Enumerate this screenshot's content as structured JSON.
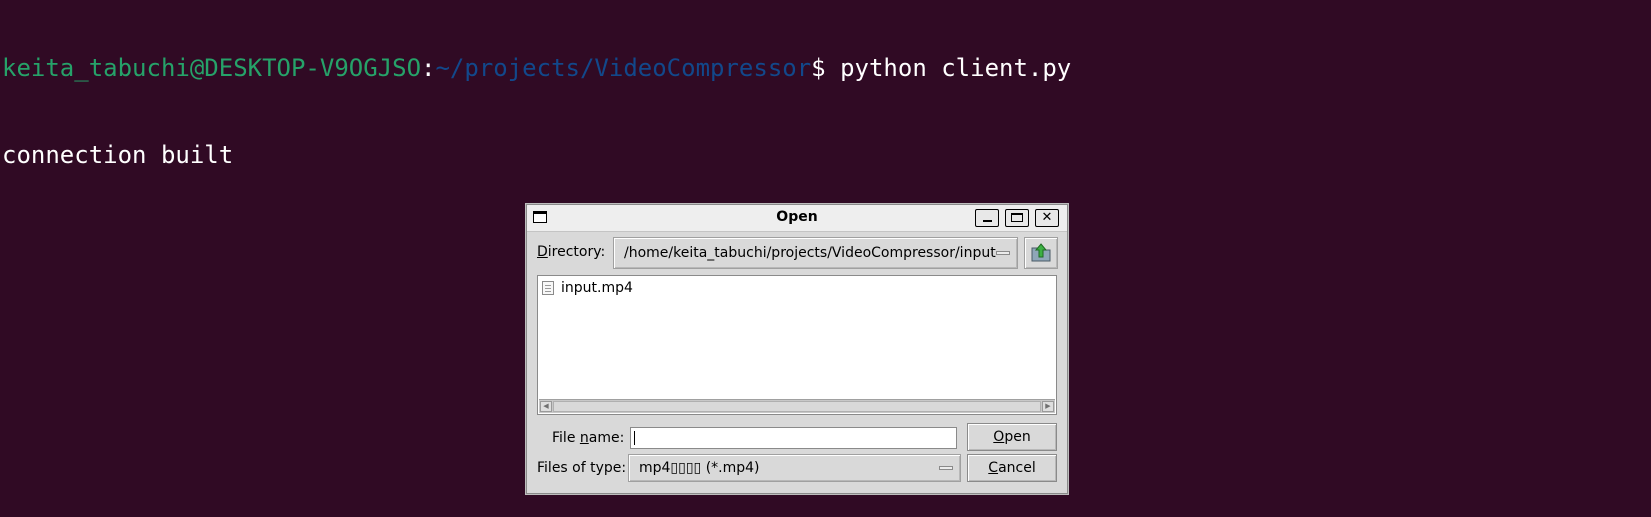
{
  "terminal": {
    "user_host": "keita_tabuchi@DESKTOP-V9OGJSO",
    "colon": ":",
    "path": "~/projects/VideoCompressor",
    "prompt_suffix": "$ python client.py",
    "output_line": "connection built",
    "colors": {
      "background": "#300a24",
      "user_host": "#26a269",
      "path": "#12488b",
      "text": "#ffffff"
    }
  },
  "dialog": {
    "title": "Open",
    "directory_label_hotkey": "D",
    "directory_label_rest": "irectory:",
    "directory_value": "/home/keita_tabuchi/projects/VideoCompressor/input",
    "up_button_icon": "folder-up-icon",
    "files": [
      {
        "name": "input.mp4",
        "icon": "file-icon"
      }
    ],
    "filename_label_pre": "File ",
    "filename_label_hotkey": "n",
    "filename_label_post": "ame:",
    "filename_value": "",
    "filetype_label": "Files of type:",
    "filetype_value": "mp4▯▯▯▯ (*.mp4)",
    "open_hotkey": "O",
    "open_rest": "pen",
    "cancel_hotkey": "C",
    "cancel_rest": "ancel",
    "window_buttons": [
      "minimize-icon",
      "maximize-icon",
      "close-icon"
    ]
  }
}
